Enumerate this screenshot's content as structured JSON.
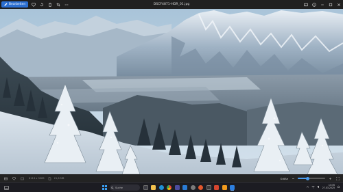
{
  "titlebar": {
    "edit_button_label": "Bearbeiten",
    "filename": "DSCF4871-HDR_01.jpg",
    "left_icons": [
      "heart-icon",
      "rotate-icon",
      "delete-icon",
      "crop-icon",
      "more-icon"
    ],
    "right_icons": [
      "image-icon",
      "info-icon",
      "minimize-icon",
      "maximize-icon",
      "close-icon"
    ]
  },
  "statusbar": {
    "dimensions": "6113 x 3385",
    "file_size": "21,6 MB",
    "zoom_label": "Größe",
    "zoom_level": 0.35
  },
  "taskbar": {
    "search_placeholder": "Suche",
    "time": "13:35",
    "date": "27.03.2025",
    "apps": [
      "file-explorer",
      "edge",
      "chrome",
      "store",
      "mail",
      "photos",
      "settings",
      "firefox",
      "terminal",
      "office",
      "vlc",
      "photos-active"
    ],
    "accent_color": "#3aa0f3"
  }
}
